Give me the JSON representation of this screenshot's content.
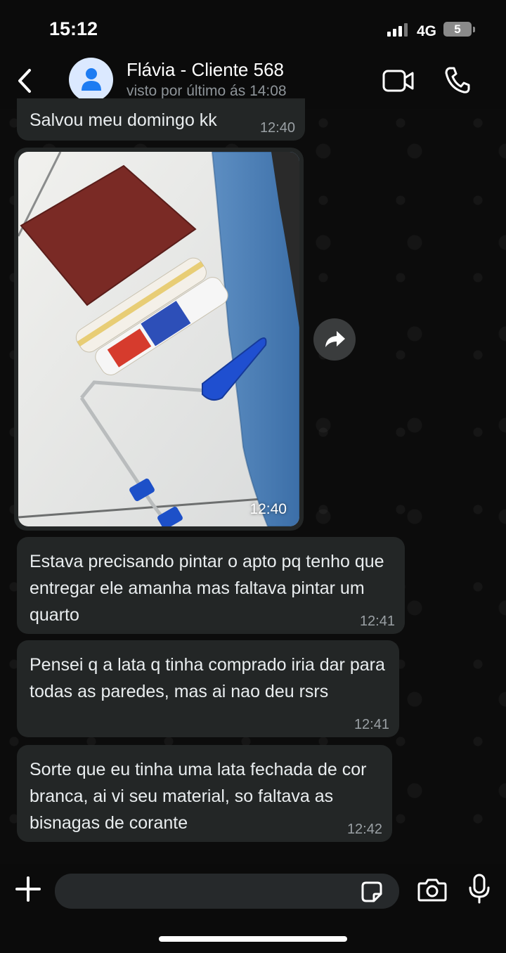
{
  "status_bar": {
    "time": "15:12",
    "network": "4G",
    "battery": "5"
  },
  "header": {
    "contact_name": "Flávia - Cliente 568",
    "last_seen": "visto por último ás 14:08"
  },
  "messages": [
    {
      "text": "Salvou meu domingo kk",
      "time": "12:40"
    },
    {
      "type": "image",
      "caption": "",
      "time": "12:40"
    },
    {
      "text": "Estava precisando pintar o apto pq tenho que entregar ele amanha mas faltava pintar um quarto",
      "time": "12:41"
    },
    {
      "text": "Pensei q a lata q tinha comprado iria dar para todas as paredes, mas ai nao deu rsrs",
      "time": "12:41"
    },
    {
      "text": "Sorte que eu tinha uma lata fechada de cor branca, ai vi seu material, so faltava as bisnagas de corante",
      "time": "12:42"
    }
  ],
  "input": {
    "placeholder": ""
  },
  "colors": {
    "bubble_bg": "#232626",
    "app_bg": "#0b0b0b",
    "avatar_bg": "#dbe9ff",
    "avatar_icon": "#1d7cf2"
  }
}
